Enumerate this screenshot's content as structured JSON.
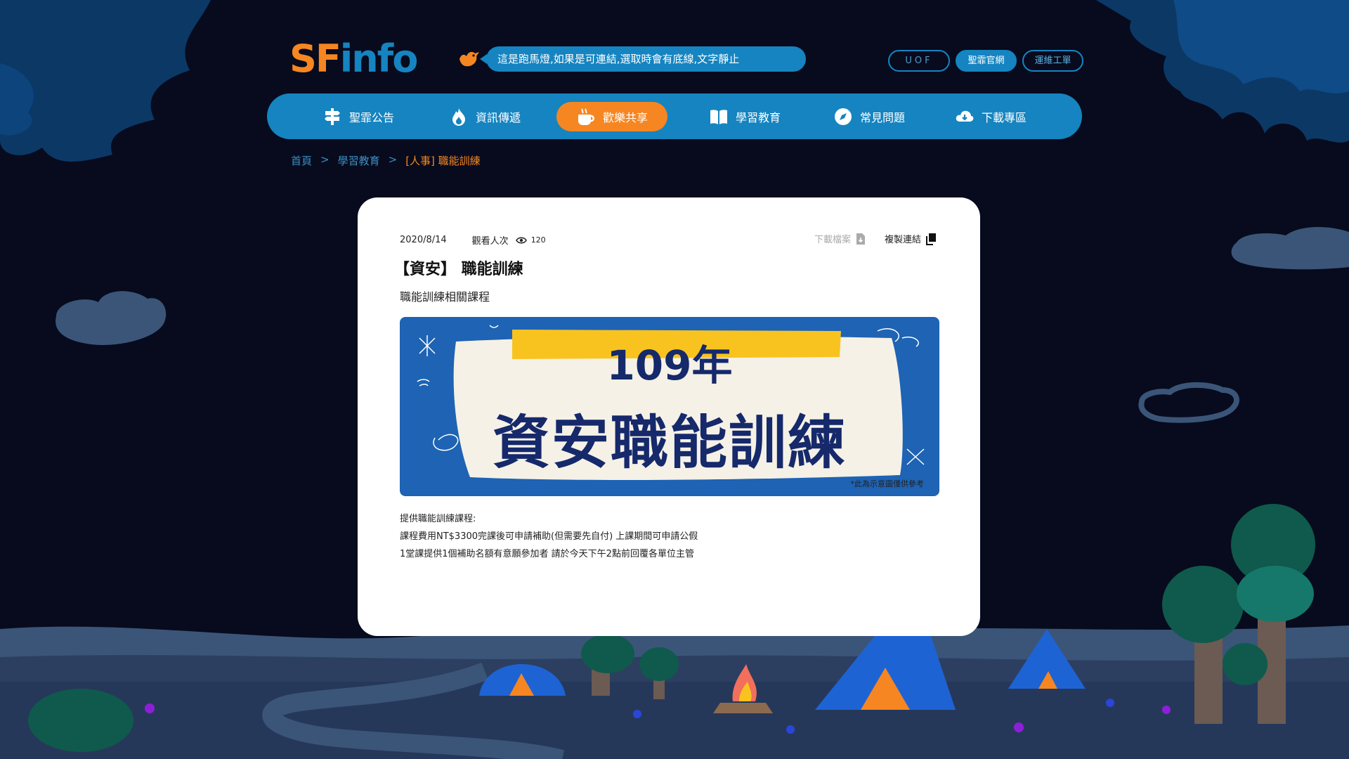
{
  "header": {
    "logo_text": "SFinfo",
    "marquee_text": "這是跑馬燈,如果是可連結,選取時會有底線,文字靜止",
    "top_links": [
      "UOF",
      "聖霏官網",
      "運維工單"
    ]
  },
  "nav": {
    "items": [
      {
        "label": "聖霏公告",
        "icon": "signpost-icon"
      },
      {
        "label": "資訊傳遞",
        "icon": "flame-icon"
      },
      {
        "label": "歡樂共享",
        "icon": "coffee-icon",
        "active": true
      },
      {
        "label": "學習教育",
        "icon": "book-icon"
      },
      {
        "label": "常見問題",
        "icon": "compass-icon"
      },
      {
        "label": "下載專區",
        "icon": "cloud-download-icon"
      }
    ]
  },
  "breadcrumb": {
    "items": [
      "首頁",
      "學習教育",
      "[人事] 職能訓練"
    ],
    "separator": ">"
  },
  "article": {
    "date": "2020/8/14",
    "views_label": "觀看人次",
    "views_count": "120",
    "download_label": "下載檔案",
    "copy_label": "複製連結",
    "title": "【資安】 職能訓練",
    "subtitle": "職能訓練相關課程",
    "banner": {
      "year": "109年",
      "main": "資安職能訓練",
      "note": "*此為示意圖僅供參考"
    },
    "body_lines": [
      "提供職能訓練課程:",
      "課程費用NT$3300完課後可申請補助(但需要先自付) 上課期間可申請公假",
      "1堂課提供1個補助名額有意願參加者 請於今天下午2點前回覆各單位主管"
    ]
  },
  "colors": {
    "background": "#070b1d",
    "accent_blue": "#1584c0",
    "accent_orange": "#f68621",
    "banner_blue": "#1e63b4",
    "banner_yellow": "#f9c31f"
  }
}
